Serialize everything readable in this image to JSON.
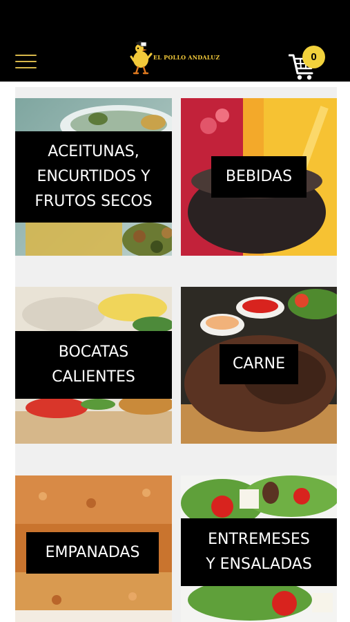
{
  "header": {
    "brand": "EL POLLO ANDALUZ",
    "cart_count": "0"
  },
  "icons": {
    "menu": "hamburger-menu-icon",
    "cart": "shopping-cart-icon",
    "logo": "chicken-mascot-logo"
  },
  "colors": {
    "header_bg": "#000000",
    "accent": "#d8b84a",
    "badge": "#f2d23c",
    "label_bg": "#000000",
    "label_text": "#ffffff"
  },
  "categories": [
    {
      "label": "ACEITUNAS,\nENCURTIDOS Y\nFRUTOS SECOS"
    },
    {
      "label": "BEBIDAS"
    },
    {
      "label": "BOCATAS\nCALIENTES"
    },
    {
      "label": "CARNE"
    },
    {
      "label": "EMPANADAS"
    },
    {
      "label": "ENTREMESES\nY ENSALADAS"
    }
  ]
}
